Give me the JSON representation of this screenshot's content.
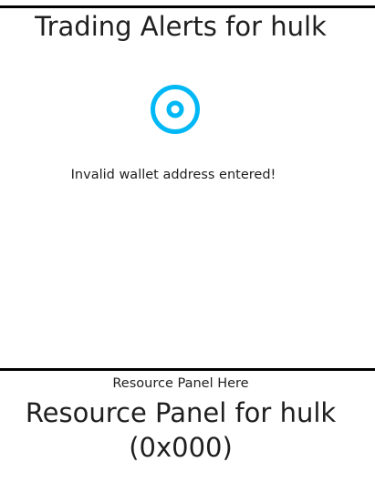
{
  "alerts": {
    "title": "Trading Alerts for hulk",
    "status_icon": "target-ring-icon",
    "icon_color": "#00b8f5",
    "error_message": "Invalid wallet address entered!"
  },
  "resource": {
    "placeholder": "Resource Panel Here",
    "title_line1": "Resource Panel for hulk",
    "title_line2": "(0x000)"
  }
}
